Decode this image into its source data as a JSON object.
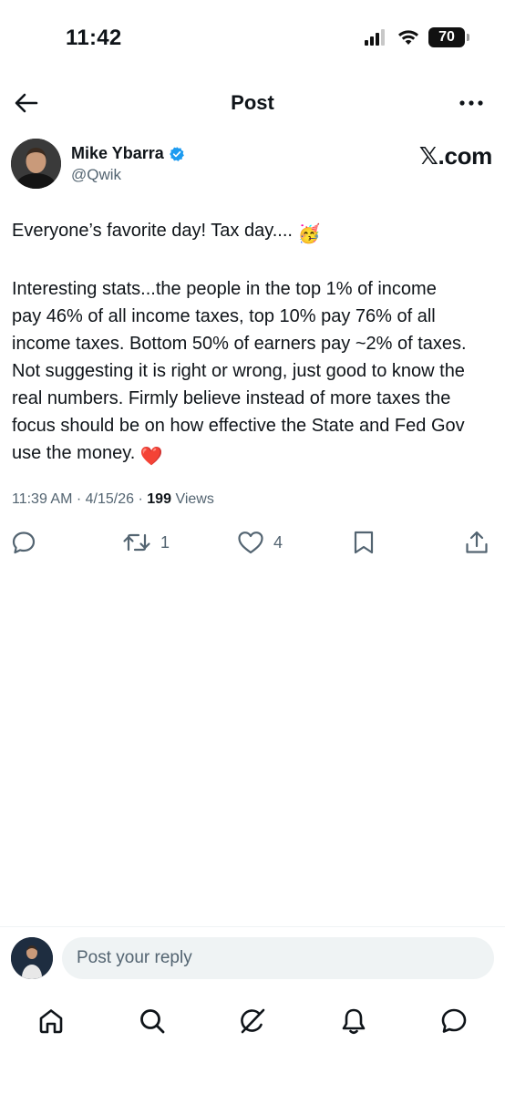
{
  "status_bar": {
    "time": "11:42",
    "battery_level": "70",
    "icons": [
      "cellular-signal-icon",
      "wifi-icon",
      "battery-icon"
    ]
  },
  "header": {
    "title": "Post",
    "back_icon": "arrow-left-icon",
    "more_icon": "more-horizontal-icon"
  },
  "author": {
    "display_name": "Mike Ybarra",
    "handle": "@Qwik",
    "verified": true,
    "verified_color": "#1d9bf0",
    "source_prefix": "𝕏",
    "source_suffix": ".com"
  },
  "post": {
    "line1": "Everyone’s favorite day! Tax day....",
    "lines": [
      "Interesting stats...the people in the top 1% of income",
      "pay 46% of all income taxes, top 10% pay 76% of all",
      "income taxes. Bottom 50% of earners pay ~2% of taxes.",
      "Not suggesting it is right or wrong, just good to know the",
      "real numbers. Firmly believe instead of more taxes the",
      "focus should be on how effective the State and Fed Gov"
    ],
    "last_line": "use the money.",
    "emoji_party": "🥳",
    "emoji_heart": "❤️",
    "time": "11:39 AM",
    "separator": "·",
    "date": "4/15/26",
    "views_count": "199",
    "views_label": "Views"
  },
  "actions": {
    "reply_count": "",
    "repost_count": "1",
    "like_count": "4",
    "icons": [
      "reply-icon",
      "repost-icon",
      "like-icon",
      "bookmark-icon",
      "share-icon"
    ]
  },
  "reply": {
    "placeholder": "Post your reply"
  },
  "tab_bar": {
    "tabs": [
      "home-icon",
      "search-icon",
      "grok-icon",
      "notifications-icon",
      "messages-icon"
    ]
  },
  "colors": {
    "text": "#0f1419",
    "secondary": "#536471",
    "accent": "#1d9bf0",
    "input_bg": "#eff3f4"
  }
}
